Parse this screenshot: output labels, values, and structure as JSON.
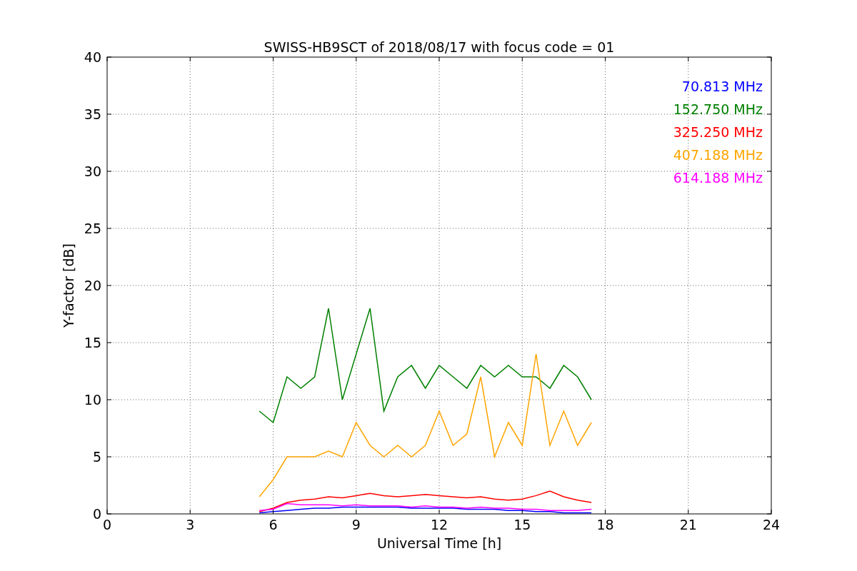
{
  "chart_data": {
    "type": "line",
    "title": "SWISS-HB9SCT of 2018/08/17 with focus code = 01",
    "xlabel": "Universal Time [h]",
    "ylabel": "Y-factor [dB]",
    "x": [
      5.5,
      6,
      6.5,
      7,
      7.5,
      8,
      8.5,
      9,
      9.5,
      10,
      10.5,
      11,
      11.5,
      12,
      12.5,
      13,
      13.5,
      14,
      14.5,
      15,
      15.5,
      16,
      16.5,
      17,
      17.5
    ],
    "series": [
      {
        "name": "70.813 MHz",
        "color": "#0000ff",
        "values": [
          0.1,
          0.2,
          0.3,
          0.4,
          0.5,
          0.5,
          0.6,
          0.6,
          0.6,
          0.6,
          0.6,
          0.5,
          0.5,
          0.5,
          0.5,
          0.4,
          0.4,
          0.4,
          0.3,
          0.3,
          0.2,
          0.2,
          0.1,
          0.1,
          0.1
        ]
      },
      {
        "name": "152.750 MHz",
        "color": "#008000",
        "values": [
          9,
          8,
          12,
          11,
          12,
          18,
          10,
          14,
          18,
          9,
          12,
          13,
          11,
          13,
          12,
          11,
          13,
          12,
          13,
          12,
          12,
          11,
          13,
          12,
          10
        ]
      },
      {
        "name": "325.250 MHz",
        "color": "#ff0000",
        "values": [
          0.2,
          0.5,
          1,
          1.2,
          1.3,
          1.5,
          1.4,
          1.6,
          1.8,
          1.6,
          1.5,
          1.6,
          1.7,
          1.6,
          1.5,
          1.4,
          1.5,
          1.3,
          1.2,
          1.3,
          1.6,
          2,
          1.5,
          1.2,
          1
        ]
      },
      {
        "name": "407.188 MHz",
        "color": "#ffa500",
        "values": [
          1.5,
          3,
          5,
          5,
          5,
          5.5,
          5,
          8,
          6,
          5,
          6,
          5,
          6,
          9,
          6,
          7,
          12,
          5,
          8,
          6,
          14,
          6,
          9,
          6,
          8
        ]
      },
      {
        "name": "614.188 MHz",
        "color": "#ff00ff",
        "values": [
          0.3,
          0.4,
          0.9,
          0.8,
          0.8,
          0.8,
          0.7,
          0.8,
          0.7,
          0.7,
          0.7,
          0.6,
          0.7,
          0.6,
          0.6,
          0.5,
          0.6,
          0.5,
          0.5,
          0.4,
          0.4,
          0.3,
          0.3,
          0.3,
          0.4
        ]
      }
    ],
    "xlim": [
      0,
      24
    ],
    "ylim": [
      0,
      40
    ],
    "xticks": [
      0,
      3,
      6,
      9,
      12,
      15,
      18,
      21,
      24
    ],
    "yticks": [
      0,
      5,
      10,
      15,
      20,
      25,
      30,
      35,
      40
    ],
    "grid": true
  }
}
